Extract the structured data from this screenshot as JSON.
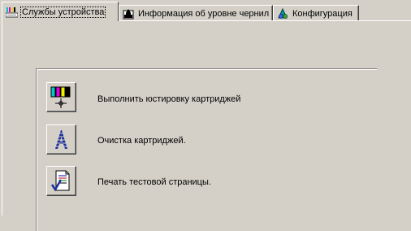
{
  "tabs": [
    {
      "label": "Службы устройства",
      "icon": "printer-services-icon",
      "active": true
    },
    {
      "label": "Информация об уровне чернил",
      "icon": "ink-drop-icon",
      "active": false
    },
    {
      "label": "Конфигурация",
      "icon": "configuration-icon",
      "active": false
    }
  ],
  "services": [
    {
      "label": "Выполнить юстировку картриджей",
      "icon": "cartridge-align-icon"
    },
    {
      "label": "Очистка картриджей.",
      "icon": "cartridge-clean-icon"
    },
    {
      "label": "Печать тестовой страницы.",
      "icon": "test-page-icon"
    }
  ],
  "colors": {
    "face": "#d4d0c8",
    "highlight": "#ffffff",
    "shadow": "#808080",
    "dark": "#404040"
  }
}
